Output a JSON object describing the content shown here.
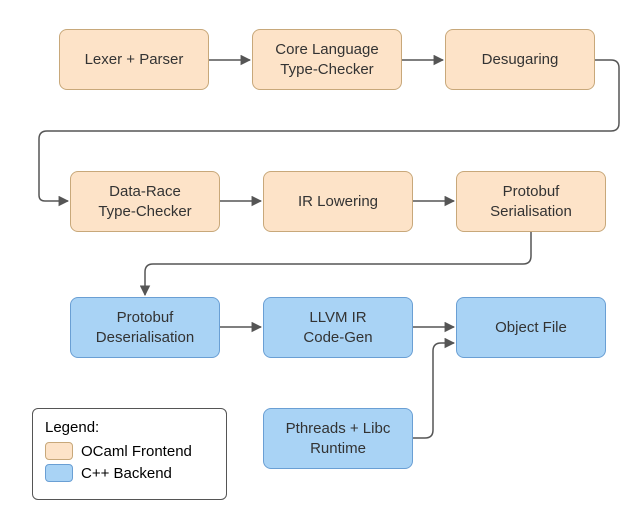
{
  "nodes": {
    "lexer": {
      "label": "Lexer + Parser"
    },
    "corets": {
      "label": "Core Language\nType-Checker"
    },
    "desugar": {
      "label": "Desugaring"
    },
    "drts": {
      "label": "Data-Race\nType-Checker"
    },
    "irlow": {
      "label": "IR Lowering"
    },
    "pbser": {
      "label": "Protobuf\nSerialisation"
    },
    "pbdes": {
      "label": "Protobuf\nDeserialisation"
    },
    "llvm": {
      "label": "LLVM IR\nCode-Gen"
    },
    "objfile": {
      "label": "Object File"
    },
    "runtime": {
      "label": "Pthreads + Libc\nRuntime"
    }
  },
  "legend": {
    "title": "Legend:",
    "ocaml": "OCaml Frontend",
    "cpp": "C++ Backend"
  },
  "colors": {
    "ocaml_fill": "#fde3c8",
    "ocaml_stroke": "#c8a87a",
    "cpp_fill": "#a9d3f5",
    "cpp_stroke": "#6a9fd4",
    "arrow": "#555555"
  },
  "edges": [
    [
      "lexer",
      "corets"
    ],
    [
      "corets",
      "desugar"
    ],
    [
      "desugar",
      "drts"
    ],
    [
      "drts",
      "irlow"
    ],
    [
      "irlow",
      "pbser"
    ],
    [
      "pbser",
      "pbdes"
    ],
    [
      "pbdes",
      "llvm"
    ],
    [
      "llvm",
      "objfile"
    ],
    [
      "runtime",
      "objfile"
    ]
  ]
}
